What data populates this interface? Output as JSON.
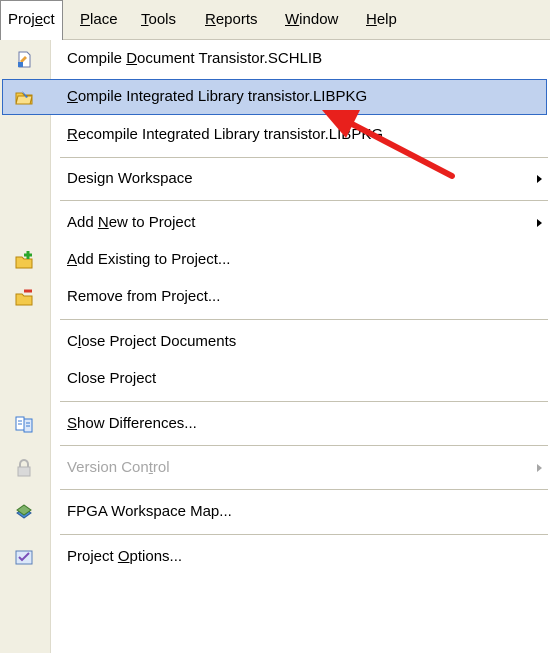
{
  "menubar": {
    "items": [
      {
        "pre": "Proj",
        "ul": "e",
        "post": "ct"
      },
      {
        "pre": "",
        "ul": "P",
        "post": "lace"
      },
      {
        "pre": "",
        "ul": "T",
        "post": "ools"
      },
      {
        "pre": "",
        "ul": "R",
        "post": "eports"
      },
      {
        "pre": "",
        "ul": "W",
        "post": "indow"
      },
      {
        "pre": "",
        "ul": "H",
        "post": "elp"
      }
    ]
  },
  "menu": {
    "items": [
      {
        "pre": "Compile ",
        "ul": "D",
        "post": "ocument Transistor.SCHLIB",
        "icon": "compile-document-icon"
      },
      {
        "pre": "",
        "ul": "C",
        "post": "ompile Integrated Library transistor.LIBPKG",
        "icon": "compile-library-icon"
      },
      {
        "pre": "",
        "ul": "R",
        "post": "ecompile Integrated Library transistor.LIBPKG"
      },
      {
        "pre": "Design Workspace",
        "ul": "",
        "post": ""
      },
      {
        "pre": "Add ",
        "ul": "N",
        "post": "ew to Project"
      },
      {
        "pre": "",
        "ul": "A",
        "post": "dd Existing to Project...",
        "icon": "add-existing-icon"
      },
      {
        "pre": "Remove from Project...",
        "ul": "",
        "post": "",
        "icon": "remove-from-project-icon"
      },
      {
        "pre": "C",
        "ul": "l",
        "post": "ose Project Documents"
      },
      {
        "pre": "Close Project",
        "ul": "",
        "post": ""
      },
      {
        "pre": "",
        "ul": "S",
        "post": "how Differences...",
        "icon": "show-differences-icon"
      },
      {
        "pre": "Version Con",
        "ul": "t",
        "post": "rol",
        "icon": "lock-icon"
      },
      {
        "pre": "FPGA Workspace Map...",
        "ul": "",
        "post": "",
        "icon": "fpga-map-icon"
      },
      {
        "pre": "Project ",
        "ul": "O",
        "post": "ptions...",
        "icon": "project-options-icon"
      }
    ]
  },
  "colors": {
    "highlight": "#c1d2ee",
    "highlight_border": "#316ac5",
    "annotation_arrow": "#e8201c"
  }
}
